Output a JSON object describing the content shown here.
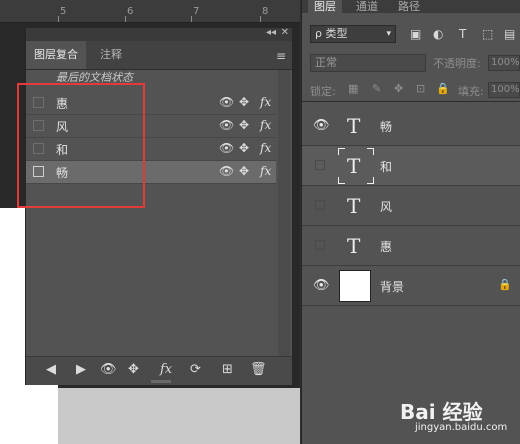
{
  "ruler": {
    "marks": [
      "5",
      "6",
      "7",
      "8"
    ]
  },
  "layer_comps_panel": {
    "collapse_glyph": "◂◂",
    "close_glyph": "✕",
    "tabs": [
      "图层复合",
      "注释"
    ],
    "menu_glyph": "≡",
    "last_document_state": "最后的文档状态",
    "comps": [
      {
        "name": "惠",
        "selected": false
      },
      {
        "name": "风",
        "selected": false
      },
      {
        "name": "和",
        "selected": false
      },
      {
        "name": "畅",
        "selected": true
      }
    ],
    "icon_glyphs": {
      "eye": "👁",
      "move": "✥",
      "fx": "fx"
    },
    "bottom_buttons": [
      "◀",
      "▶",
      "👁",
      "✥",
      "fx",
      "⟳",
      "⊞",
      "🗑"
    ]
  },
  "layers_panel": {
    "tabs": [
      "图层",
      "通道",
      "路径"
    ],
    "filter_label": "ρ 类型",
    "filter_icons": [
      "▣",
      "◐",
      "T",
      "⬚",
      "▤"
    ],
    "blend_mode": "正常",
    "opacity_label": "不透明度:",
    "opacity_value": "100%",
    "lock_label": "锁定:",
    "fill_label": "填充:",
    "fill_value": "100%",
    "lock_icons": [
      "▦",
      "✎",
      "✥",
      "⊡",
      "🔒"
    ],
    "layers": [
      {
        "name": "畅",
        "kind": "text",
        "visible": true,
        "selected": false
      },
      {
        "name": "和",
        "kind": "text",
        "visible": false,
        "selected": true
      },
      {
        "name": "风",
        "kind": "text",
        "visible": false,
        "selected": false
      },
      {
        "name": "惠",
        "kind": "text",
        "visible": false,
        "selected": false
      },
      {
        "name": "背景",
        "kind": "background",
        "visible": true,
        "selected": false,
        "locked": true
      }
    ],
    "text_thumb_glyph": "T",
    "eye_glyph": "👁",
    "lock_glyph": "🔒"
  },
  "watermark": {
    "brand": "Bai 经验",
    "url": "jingyan.baidu.com"
  },
  "highlight_color": "#e23b3b"
}
